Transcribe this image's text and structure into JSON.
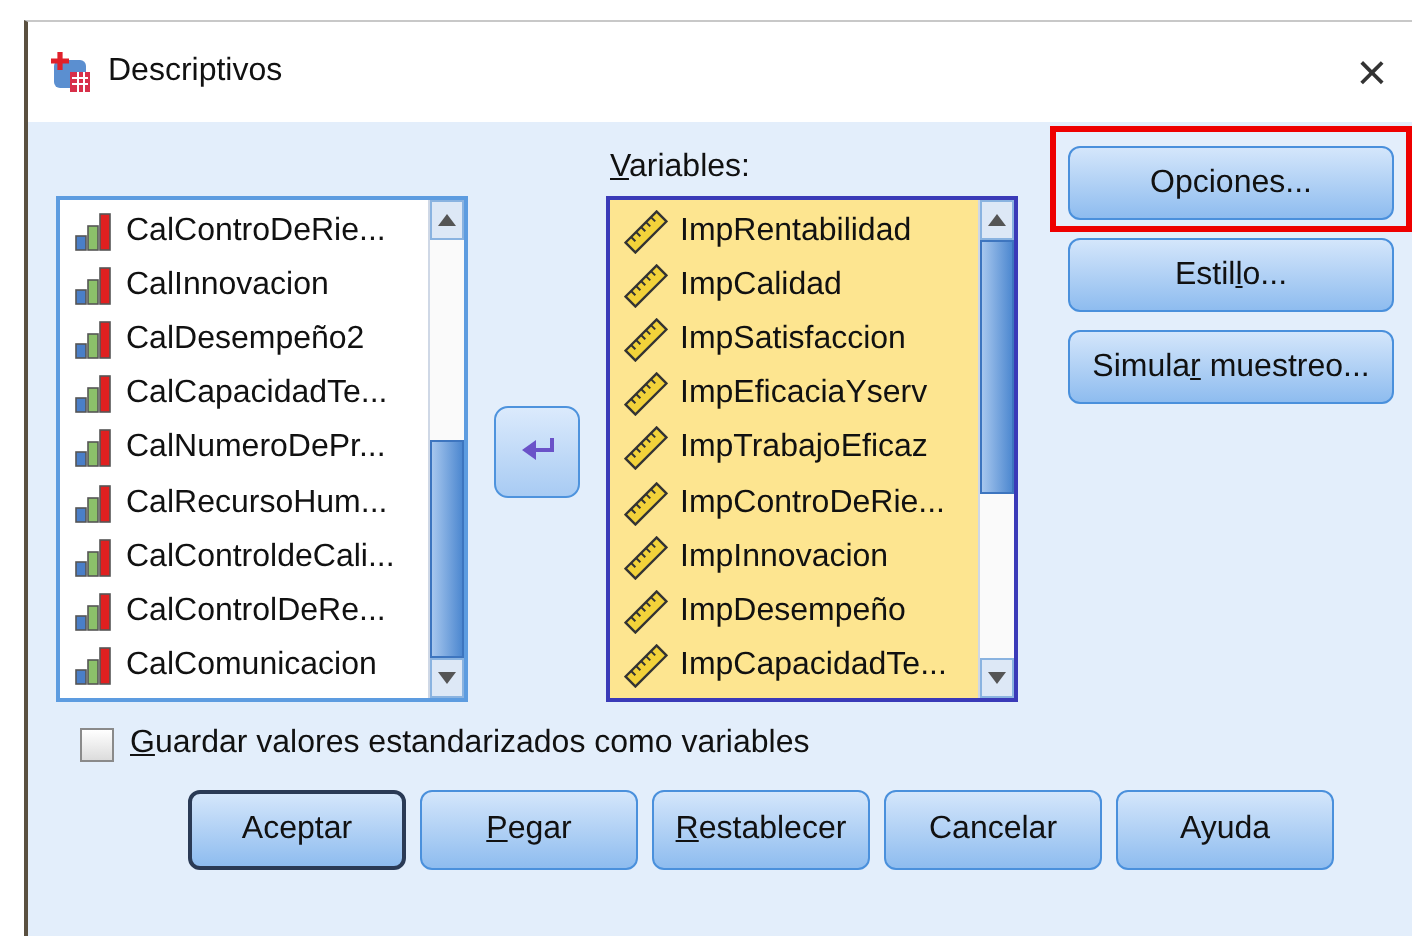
{
  "window": {
    "title": "Descriptivos",
    "close": "×"
  },
  "source_list": {
    "items": [
      {
        "name": "CalControDeRie..."
      },
      {
        "name": "CalInnovacion"
      },
      {
        "name": "CalDesempeño2"
      },
      {
        "name": "CalCapacidadTe..."
      },
      {
        "name": "CalNumeroDePr..."
      },
      {
        "name": "CalRecursoHum..."
      },
      {
        "name": "CalControldeCali..."
      },
      {
        "name": "CalControlDeRe..."
      },
      {
        "name": "CalComunicacion"
      }
    ]
  },
  "variables": {
    "label": {
      "key": "V",
      "after": "ariables:"
    },
    "items": [
      {
        "name": "ImpRentabilidad"
      },
      {
        "name": "ImpCalidad"
      },
      {
        "name": "ImpSatisfaccion"
      },
      {
        "name": "ImpEficaciaYserv"
      },
      {
        "name": "ImpTrabajoEficaz"
      },
      {
        "name": "ImpControDeRie..."
      },
      {
        "name": "ImpInnovacion"
      },
      {
        "name": "ImpDesempeño"
      },
      {
        "name": "ImpCapacidadTe..."
      }
    ]
  },
  "side_buttons": [
    {
      "label": {
        "before": "Opciones..."
      },
      "highlighted": true
    },
    {
      "label": {
        "before": "Estil",
        "key": "l",
        "after": "o..."
      },
      "highlighted": false
    },
    {
      "label": {
        "before": "Simula",
        "key": "r",
        "after": " muestreo..."
      },
      "highlighted": false
    }
  ],
  "save_option": {
    "label": {
      "key": "G",
      "after": "uardar valores estandarizados como variables"
    },
    "checked": false
  },
  "buttons": [
    {
      "label": {
        "before": "Aceptar"
      },
      "default": true
    },
    {
      "label": {
        "key": "P",
        "after": "egar"
      },
      "default": false
    },
    {
      "label": {
        "key": "R",
        "after": "establecer"
      },
      "default": false
    },
    {
      "label": {
        "before": "Cancelar"
      },
      "default": false
    },
    {
      "label": {
        "before": "Ayuda"
      },
      "default": false
    }
  ]
}
